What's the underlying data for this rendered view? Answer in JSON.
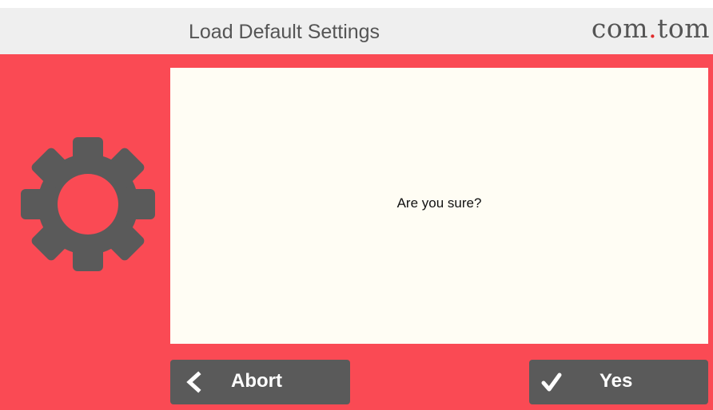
{
  "header": {
    "title": "Load Default Settings",
    "brand": {
      "part1": "com",
      "dot": ".",
      "part2": "tom"
    }
  },
  "panel": {
    "icon": "gear-icon",
    "message": "Are you sure?"
  },
  "buttons": {
    "abort": {
      "label": "Abort",
      "icon": "chevron-left-icon"
    },
    "yes": {
      "label": "Yes",
      "icon": "checkmark-icon"
    }
  },
  "colors": {
    "panel_background": "#fa4a54",
    "header_background": "#efefef",
    "message_background": "#fffdf4",
    "button_background": "#5a5a5a",
    "gear": "#5a5a5a",
    "brand_dot": "#e12a2a"
  }
}
